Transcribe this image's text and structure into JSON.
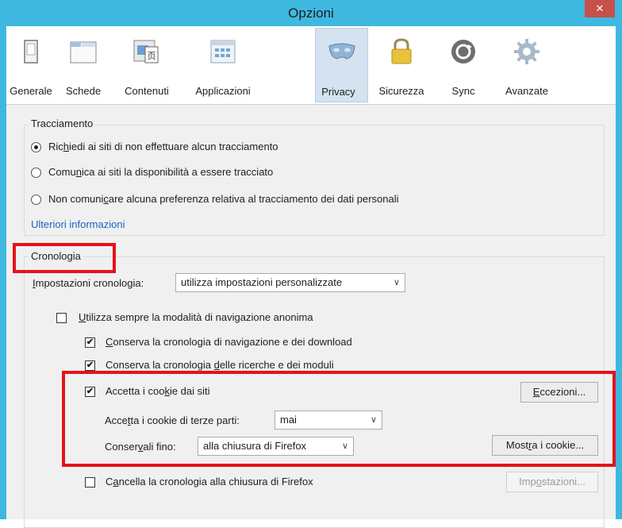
{
  "window": {
    "title": "Opzioni",
    "close_glyph": "✕"
  },
  "tabs": [
    {
      "label": "Generale",
      "icon": "generale-icon"
    },
    {
      "label": "Schede",
      "icon": "schede-icon"
    },
    {
      "label": "Contenuti",
      "icon": "contenuti-icon"
    },
    {
      "label": "Applicazioni",
      "icon": "applicazioni-icon"
    },
    {
      "label": "Privacy",
      "icon": "privacy-mask-icon",
      "selected": true
    },
    {
      "label": "Sicurezza",
      "icon": "padlock-icon"
    },
    {
      "label": "Sync",
      "icon": "sync-icon"
    },
    {
      "label": "Avanzate",
      "icon": "gear-icon"
    }
  ],
  "tracking": {
    "legend": "Tracciamento",
    "opt1": {
      "pre": "Ric",
      "u": "h",
      "post": "iedi ai siti di non effettuare alcun tracciamento",
      "selected": true
    },
    "opt2": {
      "pre": "Comu",
      "u": "n",
      "post": "ica ai siti la disponibilità a essere tracciato",
      "selected": false
    },
    "opt3": {
      "pre": "Non comuni",
      "u": "c",
      "post": "are alcuna preferenza relativa al tracciamento dei dati personali",
      "selected": false
    },
    "more_link": "Ulteriori informazioni"
  },
  "history": {
    "legend": "Cronologia",
    "settings_label": {
      "pre": "",
      "u": "I",
      "post": "mpostazioni cronologia:"
    },
    "settings_value": "utilizza impostazioni personalizzate",
    "private": {
      "pre": "",
      "u": "U",
      "post": "tilizza sempre la modalità di navigazione anonima",
      "checked": false
    },
    "keep_history": {
      "pre": "",
      "u": "C",
      "post": "onserva la cronologia di navigazione e dei download",
      "checked": true
    },
    "keep_search": {
      "pre": "Conserva la cronologia ",
      "u": "d",
      "post": "elle ricerche e dei moduli",
      "checked": true
    },
    "accept_cookies": {
      "pre": "Accetta i coo",
      "u": "k",
      "post": "ie dai siti",
      "checked": true
    },
    "exceptions_button": {
      "pre": "",
      "u": "E",
      "post": "ccezioni..."
    },
    "third_party_label": {
      "pre": "Acce",
      "u": "t",
      "post": "ta i cookie di terze parti:"
    },
    "third_party_value": "mai",
    "keep_until_label": {
      "pre": "Conser",
      "u": "v",
      "post": "ali fino:"
    },
    "keep_until_value": "alla chiusura di Firefox",
    "show_cookies_button": {
      "pre": "Most",
      "u": "r",
      "post": "a i cookie..."
    },
    "clear_on_close": {
      "pre": "C",
      "u": "a",
      "post": "ncella la cronologia alla chiusura di Firefox",
      "checked": false
    },
    "settings_button": {
      "pre": "Imp",
      "u": "o",
      "post": "stazioni..."
    }
  },
  "check_glyph": "✔",
  "dropdown_glyph": "∨",
  "colors": {
    "titlebar": "#3fb8e0",
    "close": "#c7504a",
    "highlight": "#e3141b",
    "link": "#1a62c4"
  }
}
